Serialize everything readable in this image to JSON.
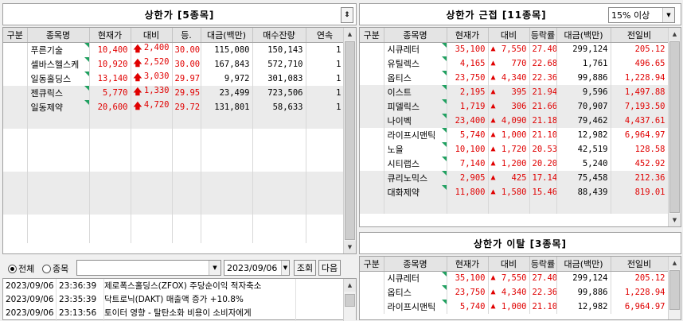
{
  "left_panel": {
    "title": "상한가 [5종목]",
    "columns": [
      "구분",
      "종목명",
      "현재가",
      "대비",
      "등.",
      "대금(백만)",
      "매수잔량",
      "연속"
    ],
    "rows": [
      {
        "name": "푸른기술",
        "price": "10,400",
        "change": "2,400",
        "rate": "30.00",
        "amount": "115,080",
        "bid": "150,143",
        "streak": "1"
      },
      {
        "name": "셀바스헬스케",
        "price": "10,920",
        "change": "2,520",
        "rate": "30.00",
        "amount": "167,843",
        "bid": "572,710",
        "streak": "1"
      },
      {
        "name": "일동홀딩스",
        "price": "13,140",
        "change": "3,030",
        "rate": "29.97",
        "amount": "9,972",
        "bid": "301,083",
        "streak": "1"
      },
      {
        "name": "젠큐릭스",
        "price": "5,770",
        "change": "1,330",
        "rate": "29.95",
        "amount": "23,499",
        "bid": "723,506",
        "streak": "1"
      },
      {
        "name": "일동제약",
        "price": "20,600",
        "change": "4,720",
        "rate": "29.72",
        "amount": "131,801",
        "bid": "58,633",
        "streak": "1"
      }
    ]
  },
  "right_top_panel": {
    "title": "상한가 근접 [11종목]",
    "filter_value": "15% 이상",
    "columns": [
      "구분",
      "종목명",
      "현재가",
      "대비",
      "등락률",
      "대금(백만)",
      "전일비"
    ],
    "rows": [
      {
        "name": "시큐레터",
        "price": "35,100",
        "change": "7,550",
        "rate": "27.40",
        "amount": "299,124",
        "prev": "205.12"
      },
      {
        "name": "유틸렉스",
        "price": "4,165",
        "change": "770",
        "rate": "22.68",
        "amount": "1,761",
        "prev": "496.65"
      },
      {
        "name": "옵티스",
        "price": "23,750",
        "change": "4,340",
        "rate": "22.36",
        "amount": "99,886",
        "prev": "1,228.94"
      },
      {
        "name": "이스트",
        "price": "2,195",
        "change": "395",
        "rate": "21.94",
        "amount": "9,596",
        "prev": "1,497.88"
      },
      {
        "name": "피델릭스",
        "price": "1,719",
        "change": "306",
        "rate": "21.66",
        "amount": "70,907",
        "prev": "7,193.50"
      },
      {
        "name": "나이벡",
        "price": "23,400",
        "change": "4,090",
        "rate": "21.18",
        "amount": "79,462",
        "prev": "4,437.61"
      },
      {
        "name": "라이프시맨틱",
        "price": "5,740",
        "change": "1,000",
        "rate": "21.10",
        "amount": "12,982",
        "prev": "6,964.97"
      },
      {
        "name": "노을",
        "price": "10,100",
        "change": "1,720",
        "rate": "20.53",
        "amount": "42,519",
        "prev": "128.58"
      },
      {
        "name": "시티랩스",
        "price": "7,140",
        "change": "1,200",
        "rate": "20.20",
        "amount": "5,240",
        "prev": "452.92"
      },
      {
        "name": "큐리노믹스",
        "price": "2,905",
        "change": "425",
        "rate": "17.14",
        "amount": "75,458",
        "prev": "212.36"
      },
      {
        "name": "대화제약",
        "price": "11,800",
        "change": "1,580",
        "rate": "15.46",
        "amount": "88,439",
        "prev": "819.01"
      }
    ]
  },
  "right_bottom_panel": {
    "title": "상한가 이탈 [3종목]",
    "columns": [
      "구분",
      "종목명",
      "현재가",
      "대비",
      "등락률",
      "대금(백만)",
      "전일비"
    ],
    "rows": [
      {
        "name": "시큐레터",
        "price": "35,100",
        "change": "7,550",
        "rate": "27.40",
        "amount": "299,124",
        "prev": "205.12"
      },
      {
        "name": "옵티스",
        "price": "23,750",
        "change": "4,340",
        "rate": "22.36",
        "amount": "99,886",
        "prev": "1,228.94"
      },
      {
        "name": "라이프시맨틱",
        "price": "5,740",
        "change": "1,000",
        "rate": "21.10",
        "amount": "12,982",
        "prev": "6,964.97"
      }
    ]
  },
  "news": {
    "radio_all": "전체",
    "radio_stock": "종목",
    "date": "2023/09/06",
    "search_btn": "조회",
    "next_btn": "다음",
    "items": [
      {
        "date": "2023/09/06",
        "time": "23:36:39",
        "text": "제로폭스홀딩스(ZFOX) 주당순이익 적자축소"
      },
      {
        "date": "2023/09/06",
        "time": "23:35:39",
        "text": "닥트로닉(DAKT) 매출액 증가 +10.8%"
      },
      {
        "date": "2023/09/06",
        "time": "23:13:56",
        "text": "토이터 영향 - 탈탄소화 비용이 소비자에게"
      }
    ]
  },
  "colors": {
    "up": "#e00000",
    "marker": "#20a060",
    "header_bg": "#e4e4e4"
  }
}
